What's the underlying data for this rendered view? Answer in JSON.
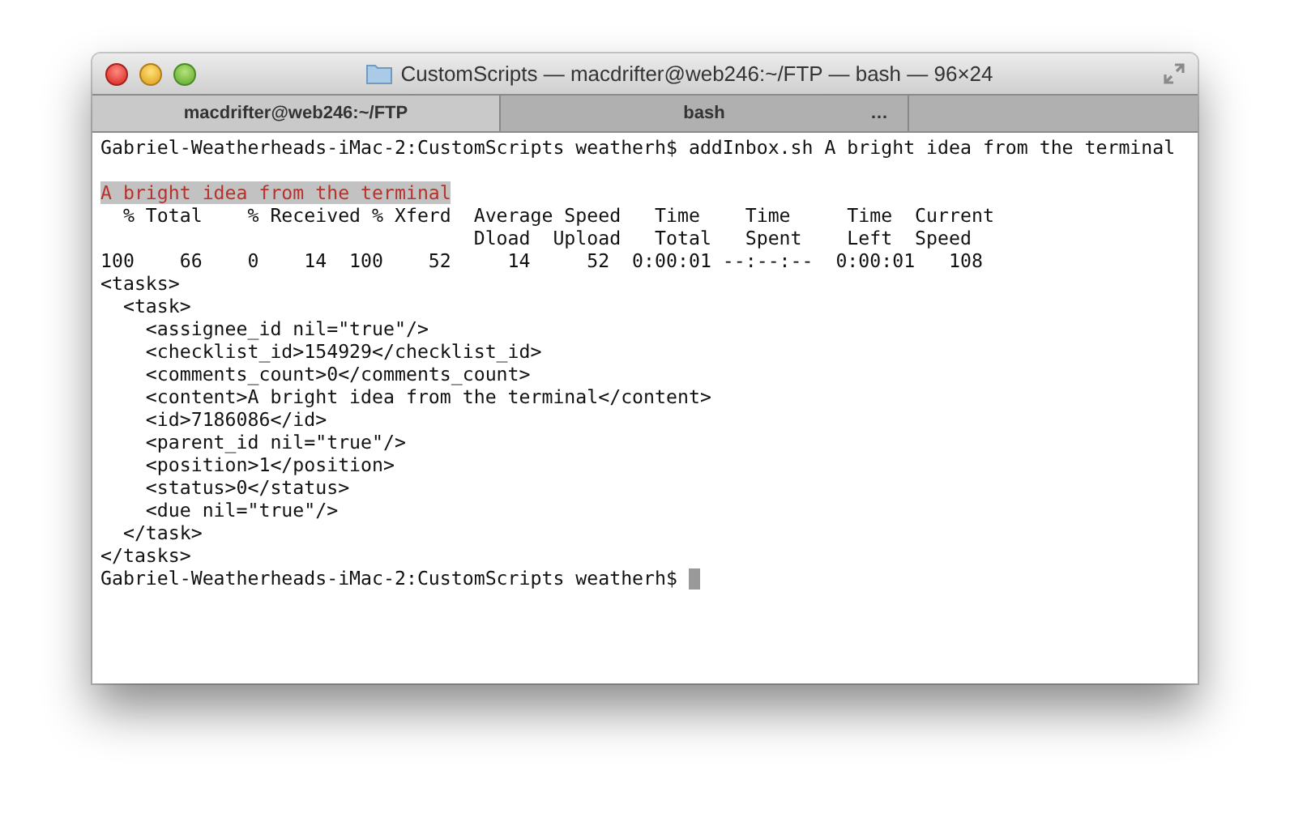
{
  "window": {
    "title": "CustomScripts — macdrifter@web246:~/FTP — bash — 96×24"
  },
  "tabs": [
    {
      "label": "macdrifter@web246:~/FTP",
      "selected": true
    },
    {
      "label": "bash",
      "selected": false,
      "overflow": "…"
    }
  ],
  "terminal": {
    "lines": [
      {
        "kind": "output",
        "text": "Gabriel-Weatherheads-iMac-2:CustomScripts weatherh$ addInbox.sh A bright idea from the terminal"
      },
      {
        "kind": "blank"
      },
      {
        "kind": "highlighted",
        "text": "A bright idea from the terminal"
      },
      {
        "kind": "output",
        "text": "  % Total    % Received % Xferd  Average Speed   Time    Time     Time  Current"
      },
      {
        "kind": "output",
        "text": "                                 Dload  Upload   Total   Spent    Left  Speed"
      },
      {
        "kind": "output",
        "text": "100    66    0    14  100    52     14     52  0:00:01 --:--:--  0:00:01   108"
      },
      {
        "kind": "output",
        "text": "<tasks>"
      },
      {
        "kind": "output",
        "text": "  <task>"
      },
      {
        "kind": "output",
        "text": "    <assignee_id nil=\"true\"/>"
      },
      {
        "kind": "output",
        "text": "    <checklist_id>154929</checklist_id>"
      },
      {
        "kind": "output",
        "text": "    <comments_count>0</comments_count>"
      },
      {
        "kind": "output",
        "text": "    <content>A bright idea from the terminal</content>"
      },
      {
        "kind": "output",
        "text": "    <id>7186086</id>"
      },
      {
        "kind": "output",
        "text": "    <parent_id nil=\"true\"/>"
      },
      {
        "kind": "output",
        "text": "    <position>1</position>"
      },
      {
        "kind": "output",
        "text": "    <status>0</status>"
      },
      {
        "kind": "output",
        "text": "    <due nil=\"true\"/>"
      },
      {
        "kind": "output",
        "text": "  </task>"
      },
      {
        "kind": "output",
        "text": "</tasks>"
      },
      {
        "kind": "prompt",
        "text": "Gabriel-Weatherheads-iMac-2:CustomScripts weatherh$ ",
        "cursor": true
      }
    ]
  }
}
